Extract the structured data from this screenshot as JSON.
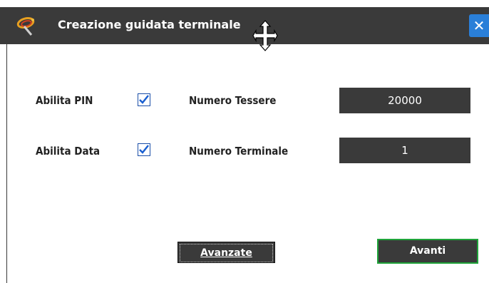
{
  "window": {
    "title": "Creazione guidata terminale",
    "close_glyph": "✕",
    "icon": "wizard-logo-icon"
  },
  "form": {
    "pin_label": "Abilita PIN",
    "pin_checked": true,
    "data_label": "Abilita Data",
    "data_checked": true,
    "tessere_label": "Numero Tessere",
    "tessere_value": "20000",
    "terminale_label": "Numero Terminale",
    "terminale_value": "1"
  },
  "buttons": {
    "advanced_label": "Avanzate",
    "next_label": "Avanti"
  },
  "colors": {
    "titlebar": "#3a3a3a",
    "close": "#2a7fd8",
    "next_border": "#1fa33a",
    "checkbox_check": "#1a5fd0"
  }
}
